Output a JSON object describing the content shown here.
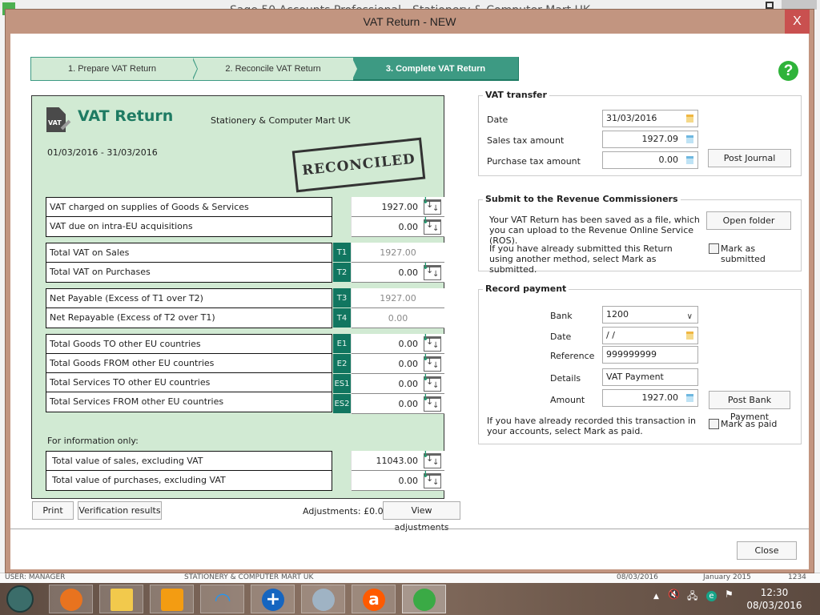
{
  "background_app": {
    "title": "Sage 50 Accounts Professional - Stationery & Computer Mart UK",
    "statusbar": [
      "USER: MANAGER",
      "STATIONERY & COMPUTER MART UK",
      "08/03/2016",
      "January 2015",
      "1234"
    ]
  },
  "dialog": {
    "title": "VAT Return - NEW",
    "close_label": "X",
    "help_label": "?"
  },
  "steps": [
    {
      "label": "1. Prepare VAT Return",
      "state": "done"
    },
    {
      "label": "2. Reconcile VAT Return",
      "state": "done"
    },
    {
      "label": "3. Complete VAT Return",
      "state": "active"
    }
  ],
  "vat_return": {
    "icon_text": "VAT",
    "title": "VAT Return",
    "company": "Stationery & Computer Mart UK",
    "period": "01/03/2016 - 31/03/2016",
    "stamp": "RECONCILED",
    "group1": [
      {
        "label": "VAT charged on supplies of Goods & Services",
        "box": "",
        "value": "1927.00",
        "readonly": false
      },
      {
        "label": "VAT due on intra-EU acquisitions",
        "box": "",
        "value": "0.00",
        "readonly": false
      }
    ],
    "group2": [
      {
        "label": "Total VAT on Sales",
        "box": "T1",
        "value": "1927.00",
        "readonly": true
      },
      {
        "label": "Total VAT on Purchases",
        "box": "T2",
        "value": "0.00",
        "readonly": false
      }
    ],
    "group3": [
      {
        "label": "Net Payable (Excess of T1 over T2)",
        "box": "T3",
        "value": "1927.00",
        "readonly": true
      },
      {
        "label": "Net Repayable (Excess of T2 over T1)",
        "box": "T4",
        "value": "0.00",
        "readonly": true
      }
    ],
    "group4": [
      {
        "label": "Total Goods TO other EU countries",
        "box": "E1",
        "value": "0.00",
        "readonly": false
      },
      {
        "label": "Total Goods FROM other EU countries",
        "box": "E2",
        "value": "0.00",
        "readonly": false
      },
      {
        "label": "Total Services TO other EU countries",
        "box": "ES1",
        "value": "0.00",
        "readonly": false
      },
      {
        "label": "Total Services FROM other EU countries",
        "box": "ES2",
        "value": "0.00",
        "readonly": false
      }
    ],
    "info_label": "For information only:",
    "group5": [
      {
        "label": "Total value of sales, excluding VAT",
        "box": "",
        "value": "11043.00",
        "readonly": false
      },
      {
        "label": "Total value of purchases, excluding VAT",
        "box": "",
        "value": "0.00",
        "readonly": false
      }
    ]
  },
  "bottom": {
    "print_label": "Print",
    "verification_label": "Verification results",
    "adjustments_text": "Adjustments: £0.00",
    "view_adjustments_label": "View adjustments",
    "close_label": "Close"
  },
  "vat_transfer": {
    "legend": "VAT transfer",
    "date_label": "Date",
    "date_value": "31/03/2016",
    "sales_label": "Sales tax amount",
    "sales_value": "1927.09",
    "purchase_label": "Purchase tax amount",
    "purchase_value": "0.00",
    "post_journal_label": "Post Journal"
  },
  "submit": {
    "legend": "Submit to the Revenue Commissioners",
    "saved_text": "Your VAT Return has been saved as a file, which you can upload to the Revenue Online Service (ROS).",
    "open_folder_label": "Open folder",
    "already_text": "If you have already submitted this Return using another method, select Mark as submitted.",
    "mark_submitted_label": "Mark as submitted",
    "mark_submitted_checked": false
  },
  "payment": {
    "legend": "Record payment",
    "bank_label": "Bank",
    "bank_value": "1200",
    "date_label": "Date",
    "date_value": " / /",
    "reference_label": "Reference",
    "reference_value": "999999999",
    "details_label": "Details",
    "details_value": "VAT Payment",
    "amount_label": "Amount",
    "amount_value": "1927.00",
    "post_bank_label": "Post Bank Payment",
    "already_text": "If you have already recorded this transaction in your accounts, select Mark as paid.",
    "mark_paid_label": "Mark as paid",
    "mark_paid_checked": false
  },
  "taskbar": {
    "apps": [
      {
        "name": "firefox",
        "color": "#e8731f"
      },
      {
        "name": "file-explorer",
        "color": "#f2c94c"
      },
      {
        "name": "outlook",
        "color": "#f39c12"
      },
      {
        "name": "wifi-app",
        "color": "#2196f3"
      },
      {
        "name": "plus-app",
        "color": "#1565c0"
      },
      {
        "name": "support-app",
        "color": "#9fb3c4"
      },
      {
        "name": "avast",
        "color": "#ff5a00"
      },
      {
        "name": "sage",
        "color": "#3aaa45"
      }
    ],
    "time": "12:30",
    "date": "08/03/2016"
  }
}
